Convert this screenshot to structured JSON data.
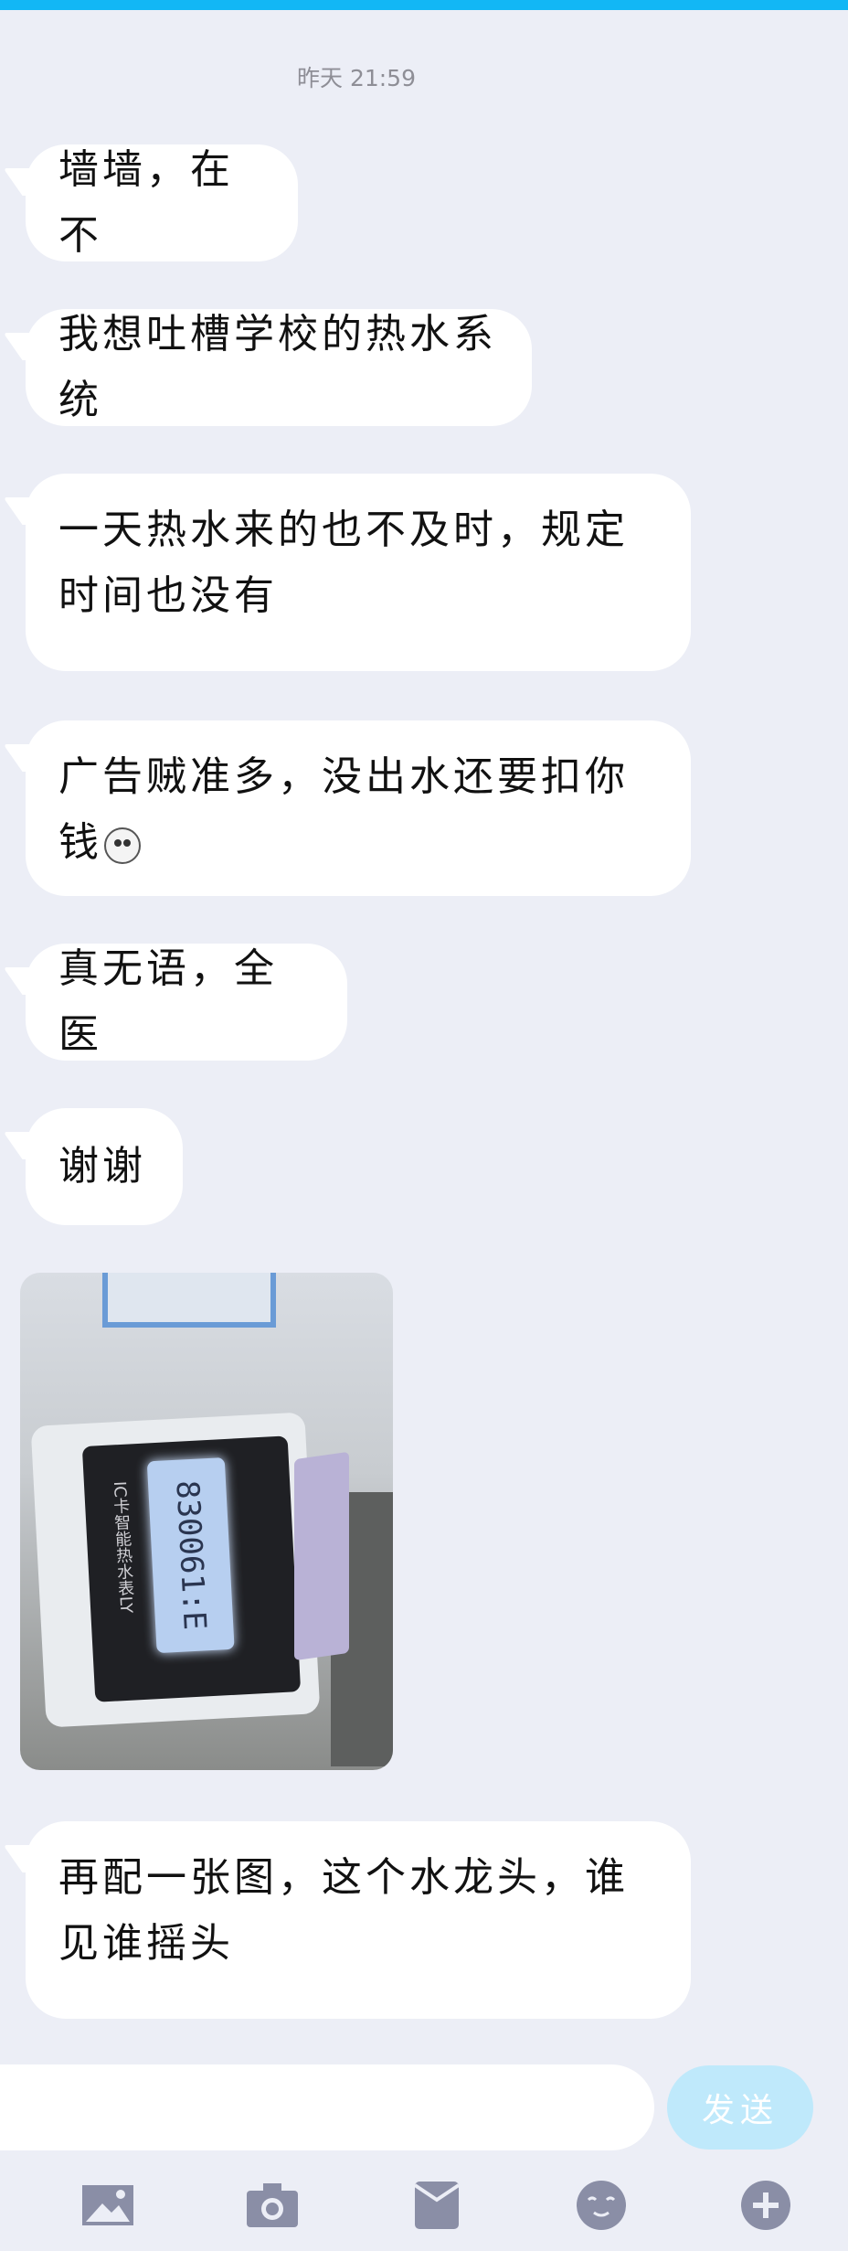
{
  "chat": {
    "timestamp": "昨天 21:59",
    "messages": [
      {
        "text": "墙墙，在不"
      },
      {
        "text": "我想吐槽学校的热水系统"
      },
      {
        "text": "一天热水来的也不及时，规定时间也没有"
      },
      {
        "text": "广告贼准多，没出水还要扣你钱"
      },
      {
        "text": "真无语，全医"
      },
      {
        "text": "谢谢"
      },
      {
        "text": "再配一张图，这个水龙头，谁见谁摇头"
      }
    ],
    "photo": {
      "lcd_reading": "830061:E",
      "meter_label": "IC卡智能热水表LY"
    }
  },
  "composer": {
    "send_label": "发送"
  },
  "toolbar": {
    "icons": [
      "image-icon",
      "camera-icon",
      "red-packet-icon",
      "emoji-icon",
      "plus-icon"
    ]
  },
  "colors": {
    "accent": "#12b7f5",
    "background": "#eceef6",
    "send_disabled": "#bfe9fb",
    "toolbar_icon": "#8a8ea6"
  }
}
